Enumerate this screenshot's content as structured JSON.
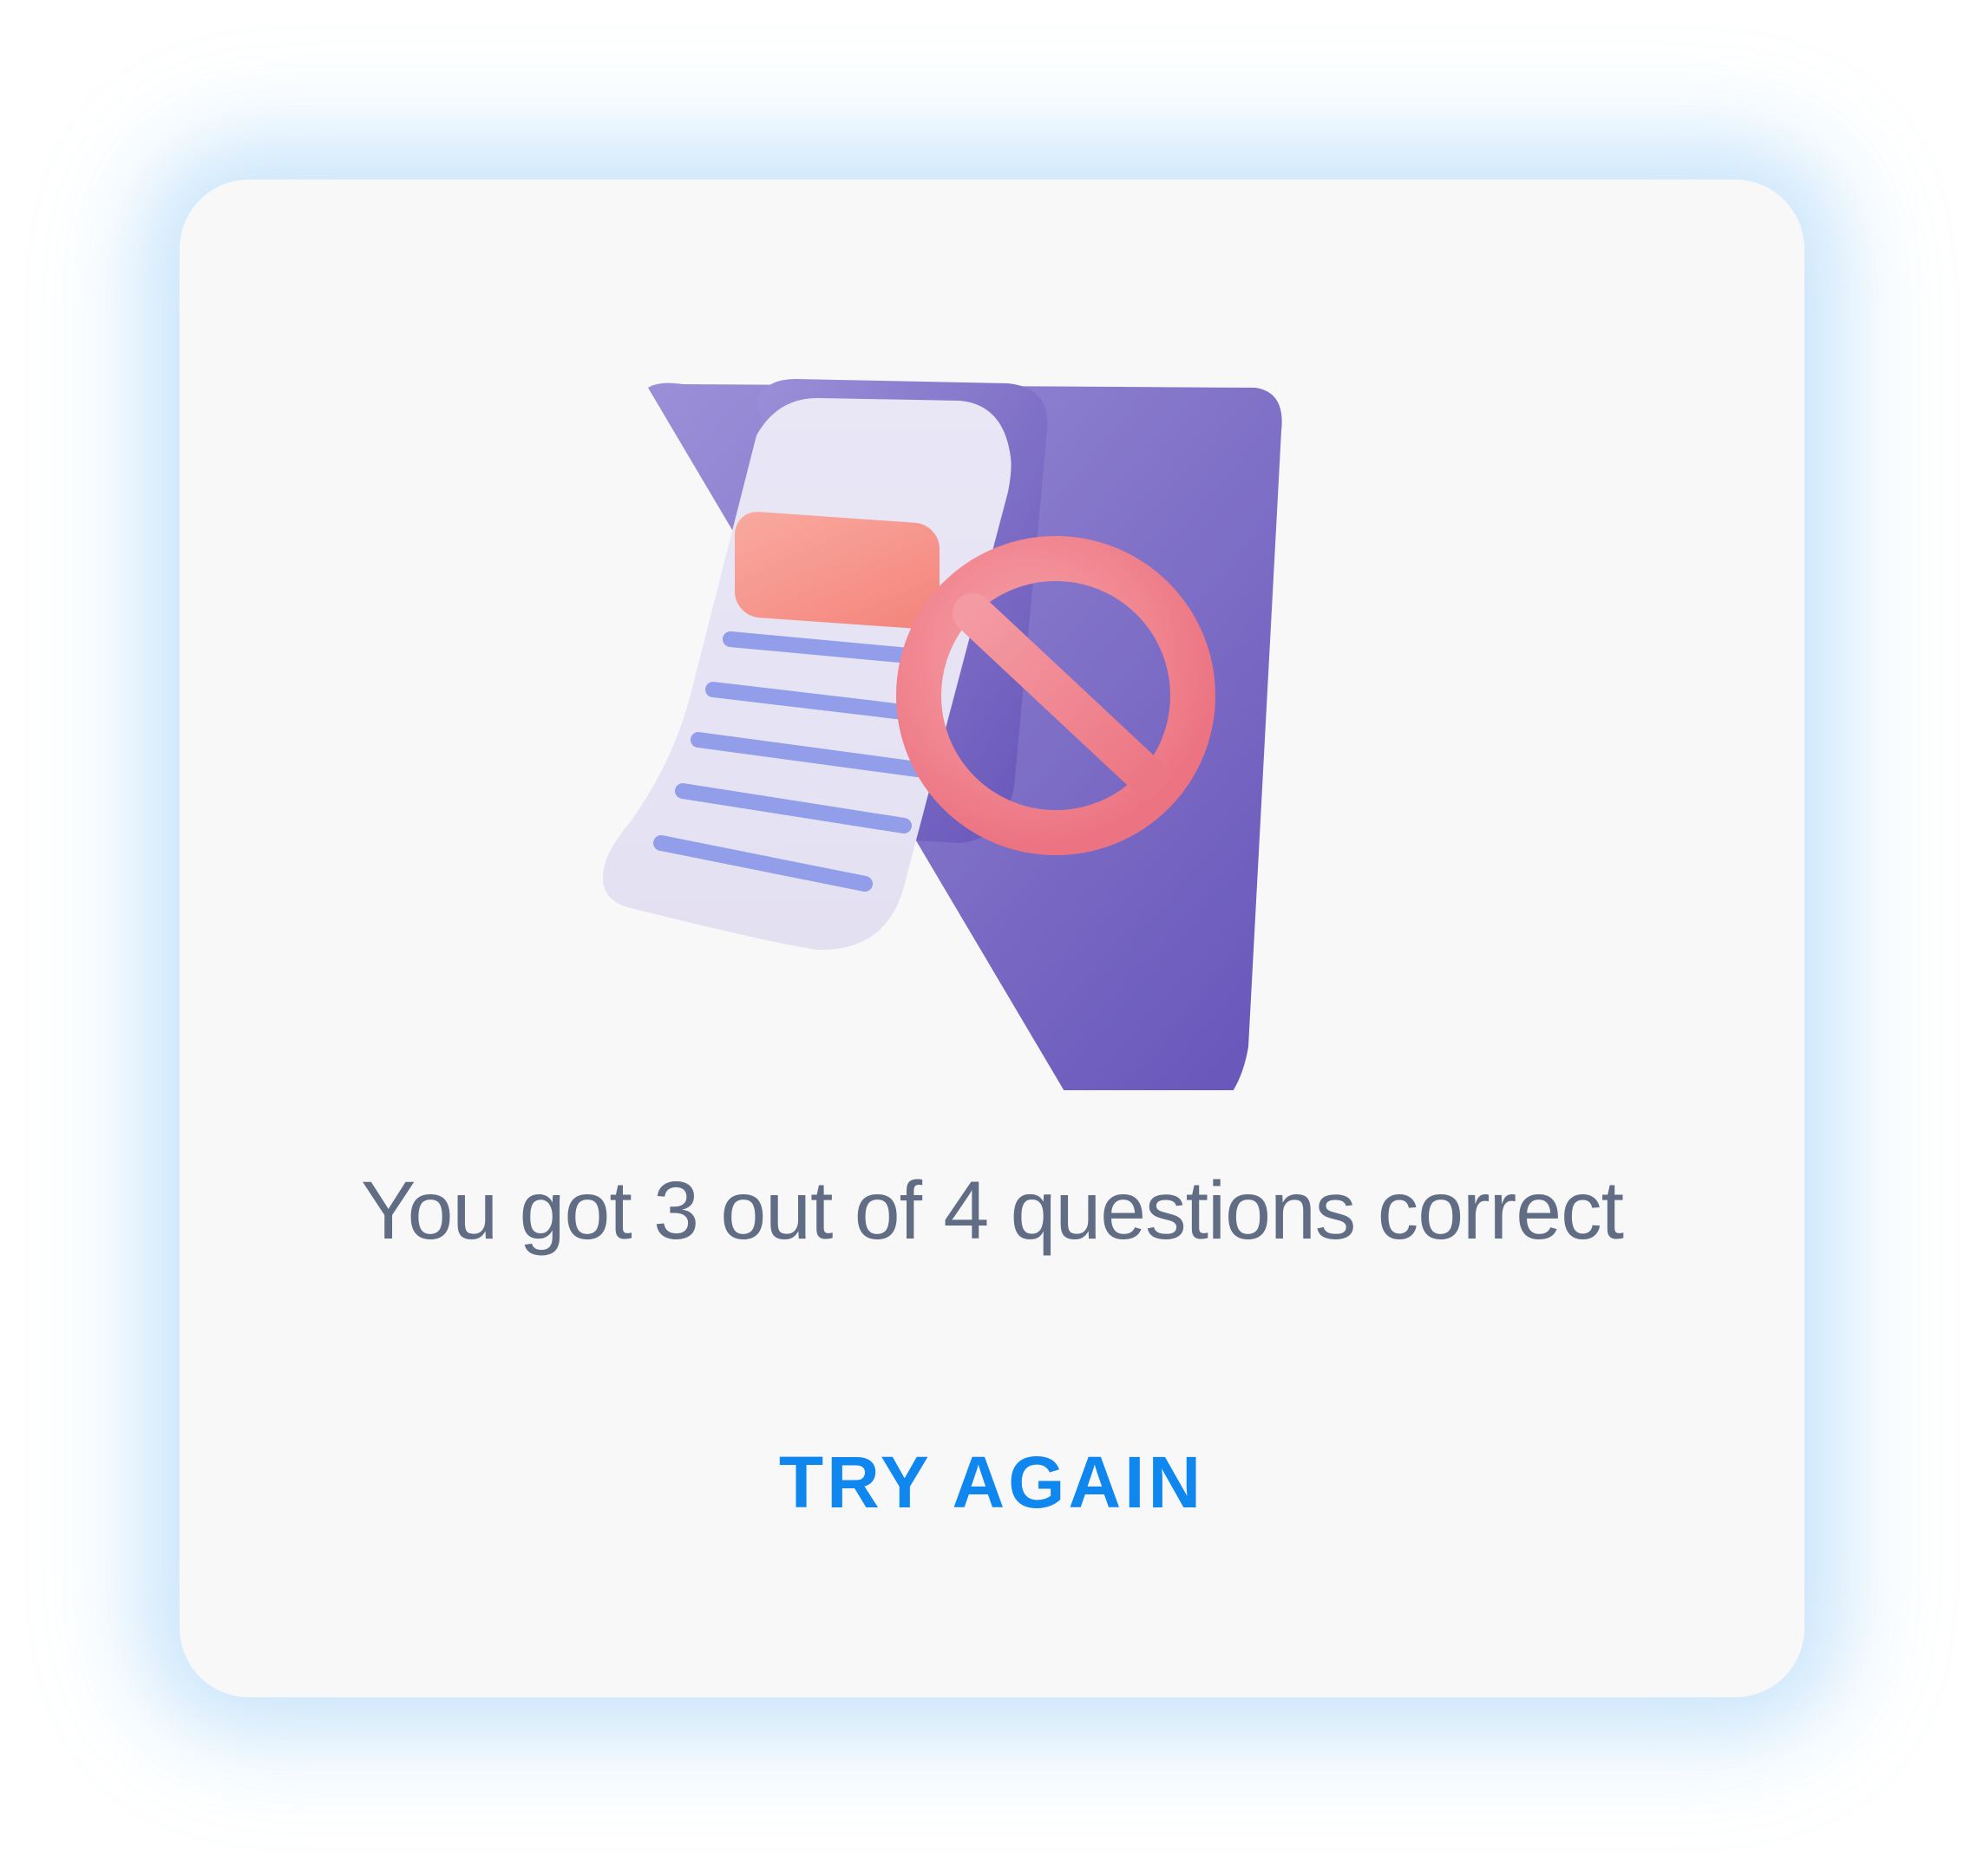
{
  "dialog": {
    "illustration_icon": "document-rejected-icon",
    "result_message": "You got 3 out of 4 questions correct",
    "try_again_label": "TRY AGAIN"
  },
  "colors": {
    "message_text": "#616c85",
    "button_text": "#0f87ef",
    "card_background": "#f8f8f9",
    "glow": "#8cc8f5"
  }
}
